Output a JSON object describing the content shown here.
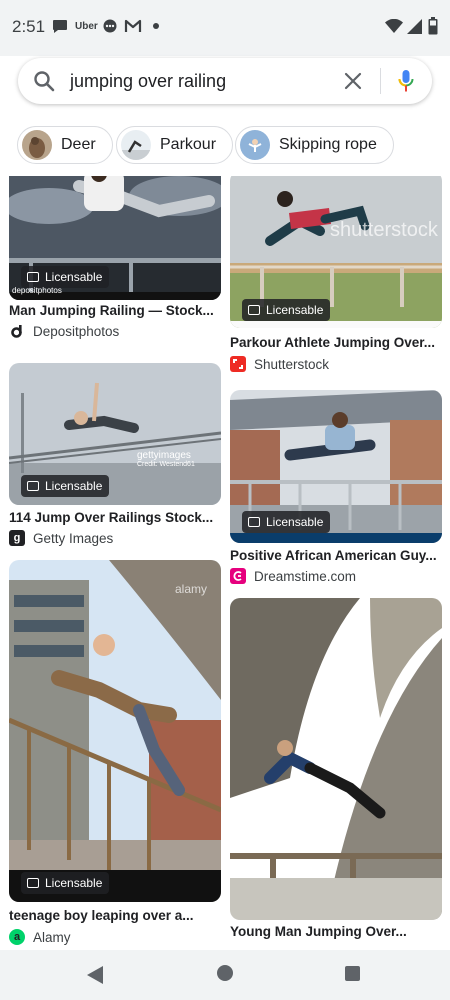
{
  "status_bar": {
    "time": "2:51",
    "uber_label": "Uber",
    "icons": [
      "chat-bubble-icon",
      "uber-icon",
      "chat-dots-icon",
      "gmail-icon",
      "dot-icon",
      "wifi-icon",
      "signal-icon",
      "battery-icon"
    ]
  },
  "search": {
    "query": "jumping over railing",
    "icons": [
      "search-icon",
      "clear-icon",
      "mic-icon"
    ]
  },
  "chips": [
    {
      "label": "Deer"
    },
    {
      "label": "Parkour"
    },
    {
      "label": "Skipping rope"
    }
  ],
  "results": {
    "left": [
      {
        "title": "Man Jumping Railing — Stock...",
        "source": "Depositphotos",
        "badge": "Licensable",
        "watermark": "depositphotos"
      },
      {
        "title": "114 Jump Over Railings Stock...",
        "source": "Getty Images",
        "badge": "Licensable",
        "watermark": "gettyimages",
        "watermark2": "Credit: Westend61"
      },
      {
        "title": "teenage boy leaping over a...",
        "source": "Alamy",
        "badge": "Licensable",
        "watermark": "alamy"
      }
    ],
    "right": [
      {
        "title": "Parkour Athlete Jumping Over...",
        "source": "Shutterstock",
        "badge": "Licensable",
        "watermark": "shutterstock"
      },
      {
        "title": "Positive African American Guy...",
        "source": "Dreamstime.com",
        "badge": "Licensable"
      },
      {
        "title": "Young Man Jumping Over..."
      }
    ]
  },
  "colors": {
    "mic_blue": "#4285f4",
    "mic_red": "#ea4335",
    "mic_yellow": "#fbbc04",
    "mic_green": "#34a853",
    "shutterstock": "#ee2b24",
    "dreamstime": "#e6007e",
    "alamy": "#00d26a",
    "getty": "#202124",
    "depositphotos": "#202124"
  },
  "nav_bar": {
    "icons": [
      "back-icon",
      "home-icon",
      "recents-icon"
    ]
  }
}
